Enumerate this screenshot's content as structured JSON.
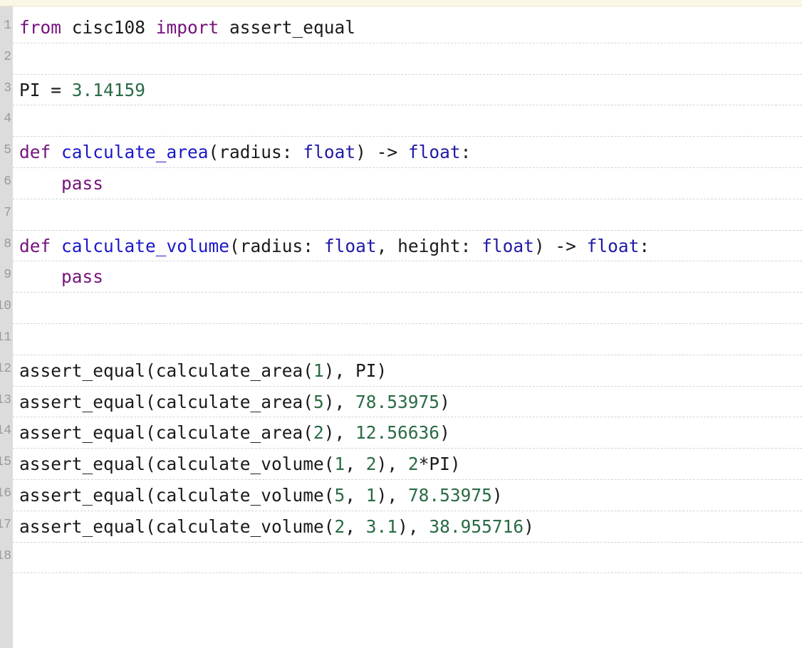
{
  "editor": {
    "lines": [
      {
        "num": "1",
        "tokens": [
          {
            "text": "from",
            "cls": "k"
          },
          {
            "text": " cisc108 ",
            "cls": ""
          },
          {
            "text": "import",
            "cls": "k"
          },
          {
            "text": " assert_equal",
            "cls": ""
          }
        ]
      },
      {
        "num": "2",
        "tokens": []
      },
      {
        "num": "3",
        "tokens": [
          {
            "text": "PI = ",
            "cls": ""
          },
          {
            "text": "3.14159",
            "cls": "n"
          }
        ]
      },
      {
        "num": "4",
        "tokens": []
      },
      {
        "num": "5",
        "tokens": [
          {
            "text": "def",
            "cls": "k"
          },
          {
            "text": " ",
            "cls": ""
          },
          {
            "text": "calculate_area",
            "cls": "d"
          },
          {
            "text": "(radius: ",
            "cls": ""
          },
          {
            "text": "float",
            "cls": "t"
          },
          {
            "text": ") -> ",
            "cls": ""
          },
          {
            "text": "float",
            "cls": "t"
          },
          {
            "text": ":",
            "cls": ""
          }
        ]
      },
      {
        "num": "6",
        "tokens": [
          {
            "text": "    ",
            "cls": ""
          },
          {
            "text": "pass",
            "cls": "k"
          }
        ]
      },
      {
        "num": "7",
        "tokens": []
      },
      {
        "num": "8",
        "tokens": [
          {
            "text": "def",
            "cls": "k"
          },
          {
            "text": " ",
            "cls": ""
          },
          {
            "text": "calculate_volume",
            "cls": "d"
          },
          {
            "text": "(radius: ",
            "cls": ""
          },
          {
            "text": "float",
            "cls": "t"
          },
          {
            "text": ", height: ",
            "cls": ""
          },
          {
            "text": "float",
            "cls": "t"
          },
          {
            "text": ") -> ",
            "cls": ""
          },
          {
            "text": "float",
            "cls": "t"
          },
          {
            "text": ":",
            "cls": ""
          }
        ]
      },
      {
        "num": "9",
        "tokens": [
          {
            "text": "    ",
            "cls": ""
          },
          {
            "text": "pass",
            "cls": "k"
          }
        ]
      },
      {
        "num": "10",
        "tokens": []
      },
      {
        "num": "11",
        "tokens": []
      },
      {
        "num": "12",
        "tokens": [
          {
            "text": "assert_equal(calculate_area(",
            "cls": ""
          },
          {
            "text": "1",
            "cls": "n"
          },
          {
            "text": "), PI)",
            "cls": ""
          }
        ]
      },
      {
        "num": "13",
        "tokens": [
          {
            "text": "assert_equal(calculate_area(",
            "cls": ""
          },
          {
            "text": "5",
            "cls": "n"
          },
          {
            "text": "), ",
            "cls": ""
          },
          {
            "text": "78.53975",
            "cls": "n"
          },
          {
            "text": ")",
            "cls": ""
          }
        ]
      },
      {
        "num": "14",
        "tokens": [
          {
            "text": "assert_equal(calculate_area(",
            "cls": ""
          },
          {
            "text": "2",
            "cls": "n"
          },
          {
            "text": "), ",
            "cls": ""
          },
          {
            "text": "12.56636",
            "cls": "n"
          },
          {
            "text": ")",
            "cls": ""
          }
        ]
      },
      {
        "num": "15",
        "tokens": [
          {
            "text": "assert_equal(calculate_volume(",
            "cls": ""
          },
          {
            "text": "1",
            "cls": "n"
          },
          {
            "text": ", ",
            "cls": ""
          },
          {
            "text": "2",
            "cls": "n"
          },
          {
            "text": "), ",
            "cls": ""
          },
          {
            "text": "2",
            "cls": "n"
          },
          {
            "text": "*PI)",
            "cls": ""
          }
        ]
      },
      {
        "num": "16",
        "tokens": [
          {
            "text": "assert_equal(calculate_volume(",
            "cls": ""
          },
          {
            "text": "5",
            "cls": "n"
          },
          {
            "text": ", ",
            "cls": ""
          },
          {
            "text": "1",
            "cls": "n"
          },
          {
            "text": "), ",
            "cls": ""
          },
          {
            "text": "78.53975",
            "cls": "n"
          },
          {
            "text": ")",
            "cls": ""
          }
        ]
      },
      {
        "num": "17",
        "tokens": [
          {
            "text": "assert_equal(calculate_volume(",
            "cls": ""
          },
          {
            "text": "2",
            "cls": "n"
          },
          {
            "text": ", ",
            "cls": ""
          },
          {
            "text": "3.1",
            "cls": "n"
          },
          {
            "text": "), ",
            "cls": ""
          },
          {
            "text": "38.955716",
            "cls": "n"
          },
          {
            "text": ")",
            "cls": ""
          }
        ]
      },
      {
        "num": "18",
        "tokens": []
      }
    ]
  },
  "colors": {
    "keyword": "#75127c",
    "function_name": "#1a18c8",
    "type": "#1f1aa6",
    "number": "#2a6b45",
    "text": "#1a1a1a",
    "gutter": "#dcdcdc",
    "line_separator": "#cfd5dc"
  }
}
